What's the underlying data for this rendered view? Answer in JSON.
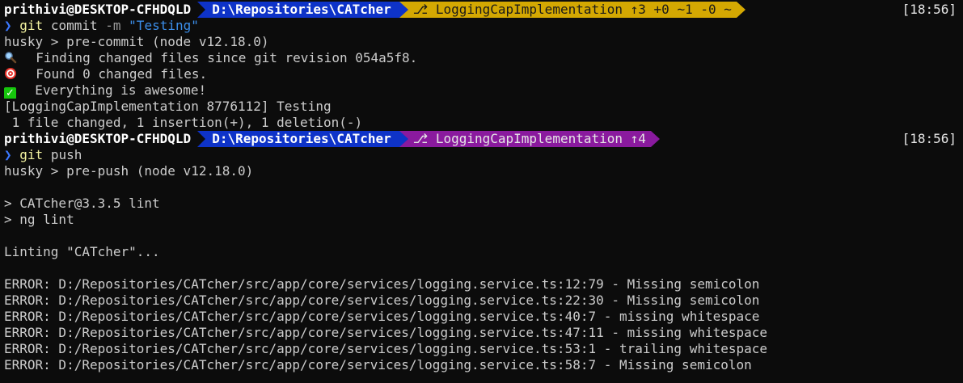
{
  "prompt1": {
    "user": "prithivi@DESKTOP-CFHDQLD",
    "path": "D:\\Repositories\\CATcher",
    "branch": "⎇ LoggingCapImplementation ↑3 +0 ~1 -0 ~",
    "time": "[18:56]",
    "chevron": "❯",
    "cmd_git": "git",
    "cmd_rest": "commit",
    "cmd_flag": "-m",
    "cmd_str": "\"Testing\""
  },
  "output1": [
    "husky > pre-commit (node v12.18.0)",
    "  Finding changed files since git revision 054a5f8.",
    "  Found 0 changed files.",
    "  Everything is awesome!",
    "[LoggingCapImplementation 8776112] Testing",
    " 1 file changed, 1 insertion(+), 1 deletion(-)"
  ],
  "prompt2": {
    "user": "prithivi@DESKTOP-CFHDQLD",
    "path": "D:\\Repositories\\CATcher",
    "branch": "⎇ LoggingCapImplementation ↑4",
    "time": "[18:56]",
    "chevron": "❯",
    "cmd_git": "git",
    "cmd_rest": "push"
  },
  "output2": [
    "husky > pre-push (node v12.18.0)",
    "",
    "> CATcher@3.3.5 lint",
    "> ng lint",
    "",
    "Linting \"CATcher\"...",
    "",
    "ERROR: D:/Repositories/CATcher/src/app/core/services/logging.service.ts:12:79 - Missing semicolon",
    "ERROR: D:/Repositories/CATcher/src/app/core/services/logging.service.ts:22:30 - Missing semicolon",
    "ERROR: D:/Repositories/CATcher/src/app/core/services/logging.service.ts:40:7 - missing whitespace",
    "ERROR: D:/Repositories/CATcher/src/app/core/services/logging.service.ts:47:11 - missing whitespace",
    "ERROR: D:/Repositories/CATcher/src/app/core/services/logging.service.ts:53:1 - trailing whitespace",
    "ERROR: D:/Repositories/CATcher/src/app/core/services/logging.service.ts:58:7 - Missing semicolon"
  ],
  "icons": {
    "line2": "magnifier-icon",
    "line3": "target-icon",
    "line4": "check-mark-icon"
  },
  "colors": {
    "background": "#0c0c0c",
    "path_segment": "#0e33c8",
    "branch_dirty": "#d4a802",
    "branch_ahead": "#8a1a9e"
  }
}
